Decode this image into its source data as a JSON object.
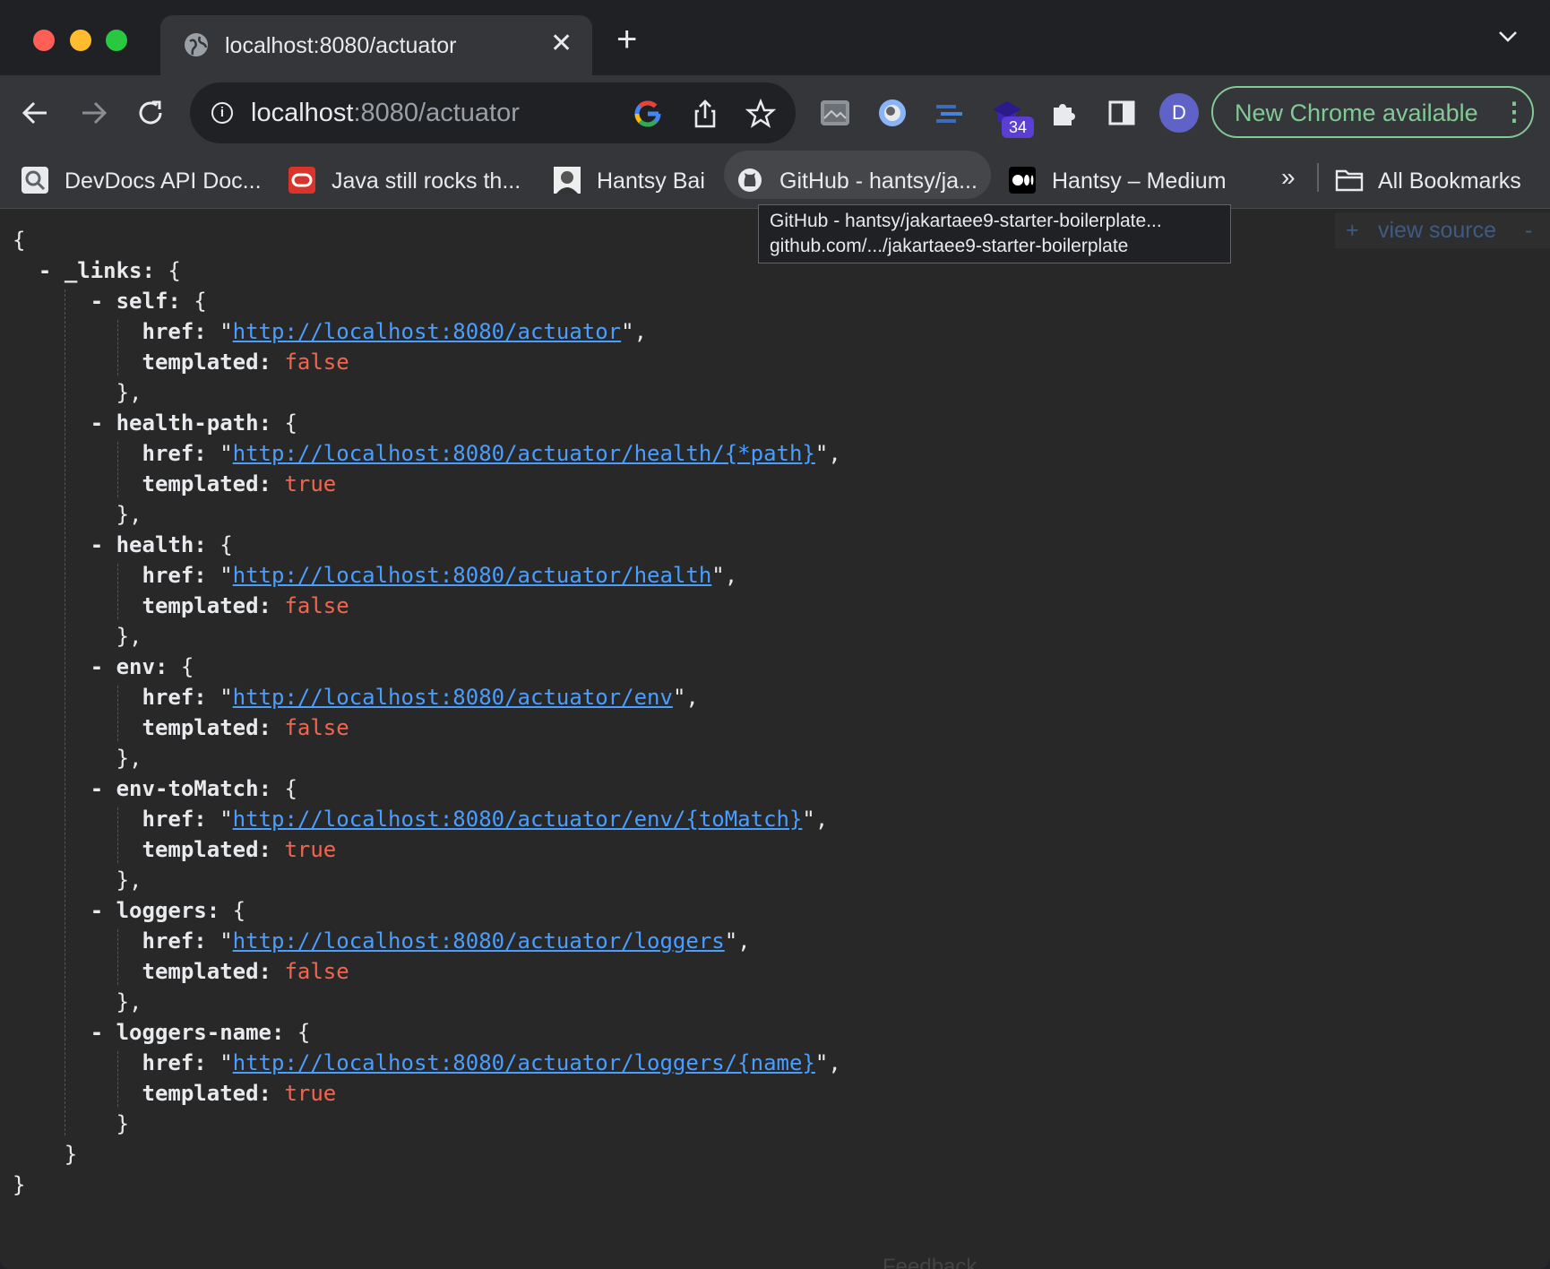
{
  "window": {
    "tab": {
      "title": "localhost:8080/actuator",
      "close_glyph": "✕"
    },
    "new_tab_glyph": "+"
  },
  "toolbar": {
    "url_host": "localhost",
    "url_path": ":8080/actuator",
    "extension_badge": "34",
    "avatar_initial": "D",
    "update_label": "New Chrome available",
    "update_menu_glyph": "⋮"
  },
  "bookmarks": {
    "items": [
      {
        "label": "DevDocs API Doc...",
        "icon": "devdocs-icon"
      },
      {
        "label": "Java still rocks th...",
        "icon": "oracle-icon"
      },
      {
        "label": "Hantsy Bai",
        "icon": "portrait-icon"
      },
      {
        "label": "GitHub - hantsy/ja...",
        "icon": "github-icon"
      },
      {
        "label": "Hantsy – Medium",
        "icon": "medium-icon"
      }
    ],
    "more_glyph": "»",
    "all_bookmarks_label": "All Bookmarks"
  },
  "tooltip": {
    "title": "GitHub - hantsy/jakartaee9-starter-boilerplate...",
    "url": "github.com/.../jakartaee9-starter-boilerplate"
  },
  "viewer": {
    "view_source_label": "view source",
    "plus_glyph": "+",
    "minus_glyph": "-",
    "feedback_label": "Feedback"
  },
  "json": {
    "root_open": "{",
    "root_close": "}",
    "links_key": "_links",
    "href_key": "href",
    "templated_key": "templated",
    "links": [
      {
        "name": "self",
        "href": "http://localhost:8080/actuator",
        "templated": "false",
        "closer": "},"
      },
      {
        "name": "health-path",
        "href": "http://localhost:8080/actuator/health/{*path}",
        "templated": "true",
        "closer": "},"
      },
      {
        "name": "health",
        "href": "http://localhost:8080/actuator/health",
        "templated": "false",
        "closer": "},"
      },
      {
        "name": "env",
        "href": "http://localhost:8080/actuator/env",
        "templated": "false",
        "closer": "},"
      },
      {
        "name": "env-toMatch",
        "href": "http://localhost:8080/actuator/env/{toMatch}",
        "templated": "true",
        "closer": "},"
      },
      {
        "name": "loggers",
        "href": "http://localhost:8080/actuator/loggers",
        "templated": "false",
        "closer": "},"
      },
      {
        "name": "loggers-name",
        "href": "http://localhost:8080/actuator/loggers/{name}",
        "templated": "true",
        "closer": "}"
      }
    ]
  }
}
